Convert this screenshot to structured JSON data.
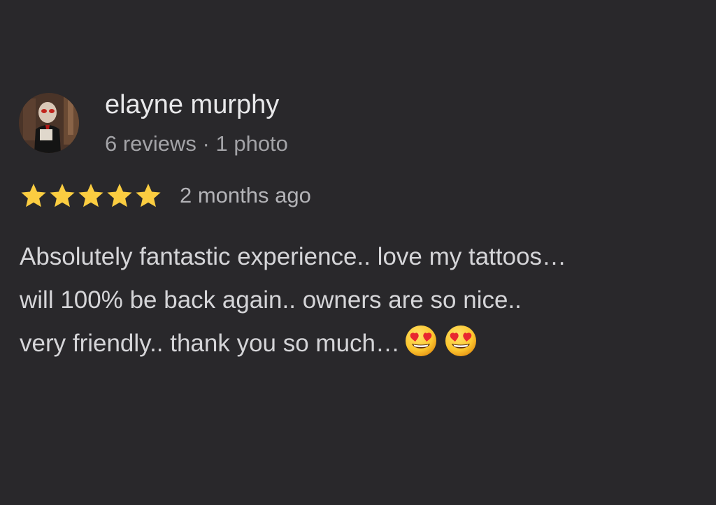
{
  "reviewer": {
    "name": "elayne murphy",
    "meta": "6 reviews · 1 photo"
  },
  "rating": {
    "stars": 5,
    "max": 5,
    "time": "2 months ago",
    "star_color": "#fbcd41"
  },
  "review": {
    "lines": [
      "Absolutely fantastic experience.. love my tattoos…",
      "will 100% be back again.. owners are so nice..",
      "very friendly.. thank you so much…"
    ],
    "trailing_emoji": [
      "smiling-face-with-heart-eyes-icon",
      "smiling-face-with-heart-eyes-icon"
    ]
  },
  "colors": {
    "background": "#29282b",
    "name": "#e8e8ea",
    "meta": "#a3a3a7",
    "body": "#d5d5d8"
  }
}
